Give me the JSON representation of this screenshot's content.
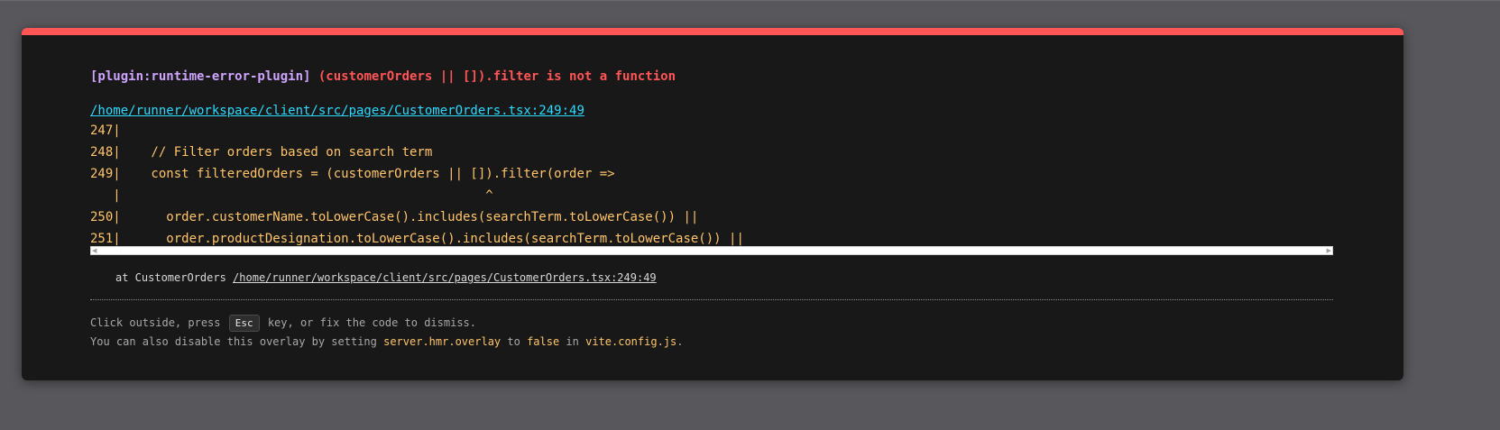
{
  "error": {
    "plugin": "[plugin:runtime-error-plugin]",
    "message": "(customerOrders || []).filter is not a function",
    "file": "/home/runner/workspace/client/src/pages/CustomerOrders.tsx:249:49"
  },
  "code_frame": [
    "247|",
    "248|    // Filter orders based on search term",
    "249|    const filteredOrders = (customerOrders || []).filter(order =>",
    "   |                                                ^",
    "250|      order.customerName.toLowerCase().includes(searchTerm.toLowerCase()) ||",
    "251|      order.productDesignation.toLowerCase().includes(searchTerm.toLowerCase()) ||"
  ],
  "stack": {
    "prefix": "at CustomerOrders ",
    "link": "/home/runner/workspace/client/src/pages/CustomerOrders.tsx:249:49"
  },
  "tip": {
    "line1_a": "Click outside, press ",
    "key": "Esc",
    "line1_b": " key, or fix the code to dismiss.",
    "line2_a": "You can also disable this overlay by setting ",
    "setting": "server.hmr.overlay",
    "line2_b": " to ",
    "value": "false",
    "line2_c": " in ",
    "config": "vite.config.js",
    "line2_d": "."
  },
  "colors": {
    "accent": "#ff5555",
    "plugin": "#cfa4ff",
    "link": "#2dd9fe",
    "code": "#ffc46b",
    "backdrop": "#58585c",
    "panel": "#181818"
  },
  "icons": {
    "scroll_left": "scroll-left-arrow-icon",
    "scroll_right": "scroll-right-arrow-icon"
  }
}
